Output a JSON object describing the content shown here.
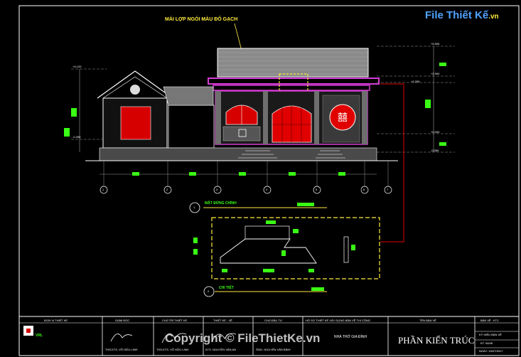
{
  "drawing": {
    "roof_note": "MÁI LỢP NGÓI MÀU ĐỎ GẠCH",
    "levels": [
      "+5.500",
      "+4.120",
      "+2.900",
      "+2.200",
      "+0.000",
      "-0.250",
      "-0.350"
    ],
    "grid_labels": [
      "1",
      "2",
      "3",
      "4",
      "5",
      "6",
      "7"
    ],
    "elevation_title": "MẶT ĐỨNG CHÍNH",
    "section_title": "CHI TIẾT",
    "section_number_1": "1",
    "section_number_2": "2"
  },
  "logo": {
    "brand_main": "File",
    "brand_second": "Thiết Kế",
    "brand_suffix": ".vn"
  },
  "title_block": {
    "col1_header": "ĐƠN VỊ THIẾT KẾ",
    "col2_header": "GIÁM ĐỐC",
    "col3_header": "CHỦ TRÌ THIẾT KẾ",
    "col4_header": "THIẾT KẾ - VẼ",
    "col5_header": "CHỦ ĐẦU TƯ",
    "col6_header": "HỒ SƠ THIẾT KẾ XÂY DỰNG BẢN VẼ THI CÔNG",
    "col7_header": "TÊN BẢN VẼ",
    "col8_header": "BẢN VẼ : KTC",
    "company": "VRL",
    "project": "NHÀ THỜ GIA ĐÌNH",
    "drawing_name": "PHẦN KIẾN TRÚC",
    "sheet_label": "KÝ HIỆU BẢN VẼ",
    "sheet_no": "KT: 04/08",
    "date": "NGÀY: 10/07/2017",
    "signer_director": "THS.KTS. VÕ HỮU LINH",
    "signer_lead": "THS.KTS. VÕ HỮU LINH",
    "signer_drafter": "KTS. NGUYỄN VĂN AN",
    "owner": "ÔNG. NGUYỄN VĂN BÌNH"
  },
  "watermark": {
    "text": "Copyright © FileThietKe.vn"
  },
  "colors": {
    "background": "#000000",
    "magenta": "#d63bd6",
    "red": "#e00000",
    "yellow": "#ffeb3b",
    "green": "#39ff14",
    "gray": "#9a9a9a"
  }
}
